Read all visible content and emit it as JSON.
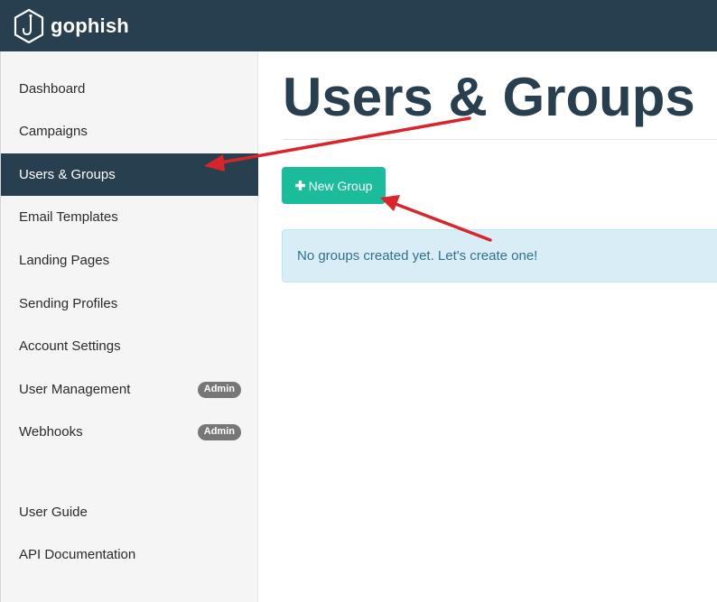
{
  "app": {
    "brand": "gophish"
  },
  "sidebar": {
    "items": [
      {
        "label": "Dashboard",
        "active": false,
        "badge": ""
      },
      {
        "label": "Campaigns",
        "active": false,
        "badge": ""
      },
      {
        "label": "Users & Groups",
        "active": true,
        "badge": ""
      },
      {
        "label": "Email Templates",
        "active": false,
        "badge": ""
      },
      {
        "label": "Landing Pages",
        "active": false,
        "badge": ""
      },
      {
        "label": "Sending Profiles",
        "active": false,
        "badge": ""
      },
      {
        "label": "Account Settings",
        "active": false,
        "badge": ""
      },
      {
        "label": "User Management",
        "active": false,
        "badge": "Admin"
      },
      {
        "label": "Webhooks",
        "active": false,
        "badge": "Admin"
      }
    ],
    "footer_items": [
      {
        "label": "User Guide"
      },
      {
        "label": "API Documentation"
      }
    ]
  },
  "main": {
    "title": "Users & Groups",
    "new_group_label": "New Group",
    "empty_message": "No groups created yet. Let's create one!"
  },
  "colors": {
    "topbar": "#283f50",
    "accent": "#1abc9c",
    "alert_bg": "#d9edf7",
    "alert_text": "#31708f",
    "annotation_arrow": "#d9252a"
  },
  "icons": {
    "logo": "fish-hook-hexagon-icon",
    "new_group": "plus-icon"
  }
}
